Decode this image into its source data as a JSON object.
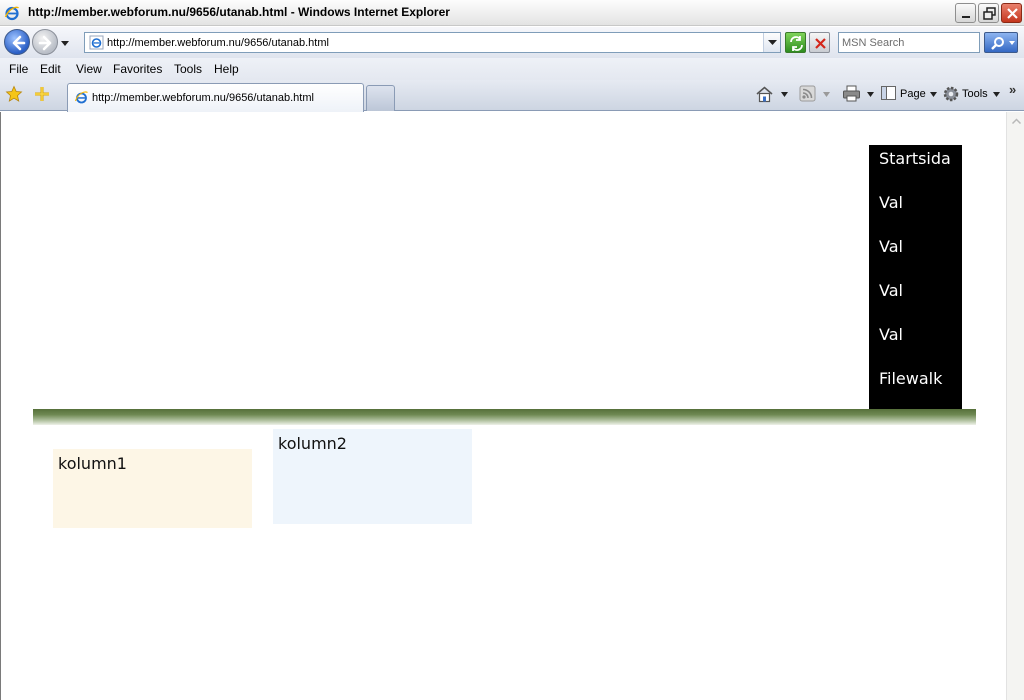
{
  "window": {
    "title": "http://member.webforum.nu/9656/utanab.html - Windows Internet Explorer"
  },
  "address_bar": {
    "url": "http://member.webforum.nu/9656/utanab.html"
  },
  "search": {
    "placeholder": "MSN Search"
  },
  "menu": {
    "items": [
      "File",
      "Edit",
      "View",
      "Favorites",
      "Tools",
      "Help"
    ]
  },
  "tabs": [
    {
      "title": "http://member.webforum.nu/9656/utanab.html",
      "active": true
    }
  ],
  "toolbar": {
    "page_label": "Page",
    "tools_label": "Tools",
    "more": "»"
  },
  "page": {
    "nav": [
      "Startsida",
      "Val",
      "Val",
      "Val",
      "Val",
      "Filewalk"
    ],
    "column1": "kolumn1",
    "column2": "kolumn2"
  },
  "colors": {
    "nav_bg": "#000000",
    "band_green": "#56703a",
    "column1_bg": "#fdf6e6",
    "column2_bg": "#eef5fc"
  }
}
